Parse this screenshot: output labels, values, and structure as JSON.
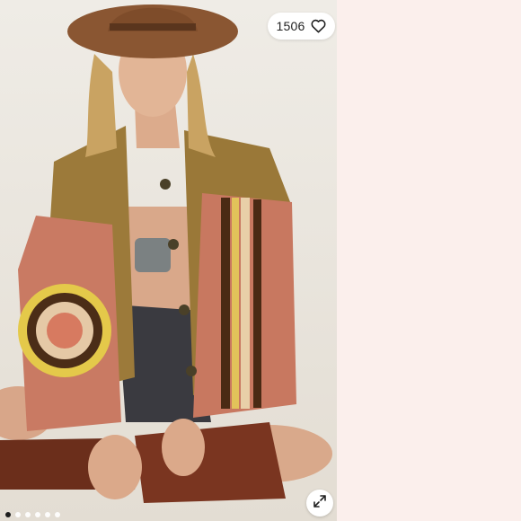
{
  "listing": {
    "like_count": "1506",
    "photo_count": 6,
    "active_photo": 0
  },
  "icons": {
    "like": "heart-outline-icon",
    "expand": "expand-arrows-icon"
  },
  "colors": {
    "page_background": "#fbefec",
    "pill_background": "#ffffff",
    "active_dot": "#1c1c1c",
    "inactive_dot": "#ffffff"
  }
}
